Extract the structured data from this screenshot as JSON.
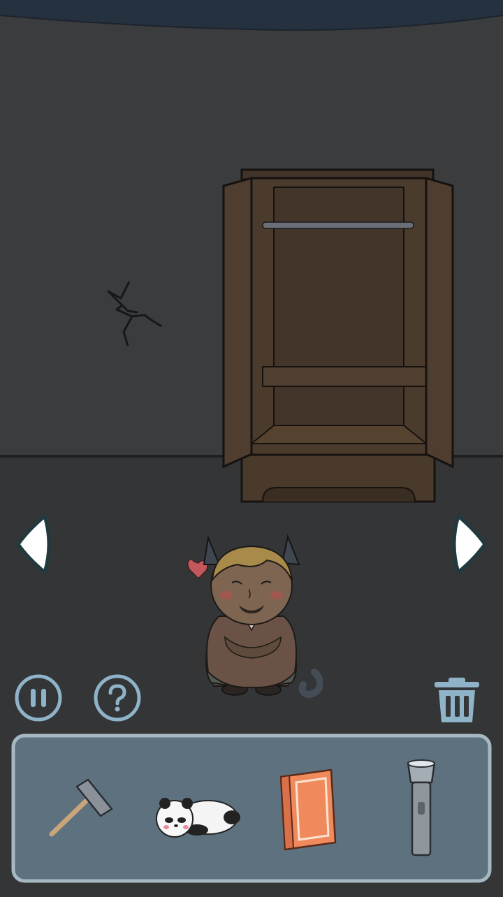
{
  "scene": {
    "room": "wardrobe-room",
    "wardrobe_state": "open-empty",
    "wall_feature": "crack"
  },
  "controls": {
    "left_arrow_icon": "chevron-left-icon",
    "right_arrow_icon": "chevron-right-icon",
    "pause_icon": "pause-icon",
    "hint_icon": "question-mark-icon",
    "trash_icon": "trash-icon"
  },
  "inventory": {
    "items": [
      {
        "name": "hammer",
        "icon": "hammer-icon"
      },
      {
        "name": "panda-plush",
        "icon": "panda-icon"
      },
      {
        "name": "book",
        "icon": "book-icon"
      },
      {
        "name": "flashlight",
        "icon": "flashlight-icon"
      }
    ]
  },
  "colors": {
    "wall": "#3b3c3e",
    "floor": "#333436",
    "wardrobe": "#4a3a2c",
    "ui_blue": "#8fb3c8",
    "inventory_bg": "#5e717f",
    "book": "#f08a5d"
  }
}
